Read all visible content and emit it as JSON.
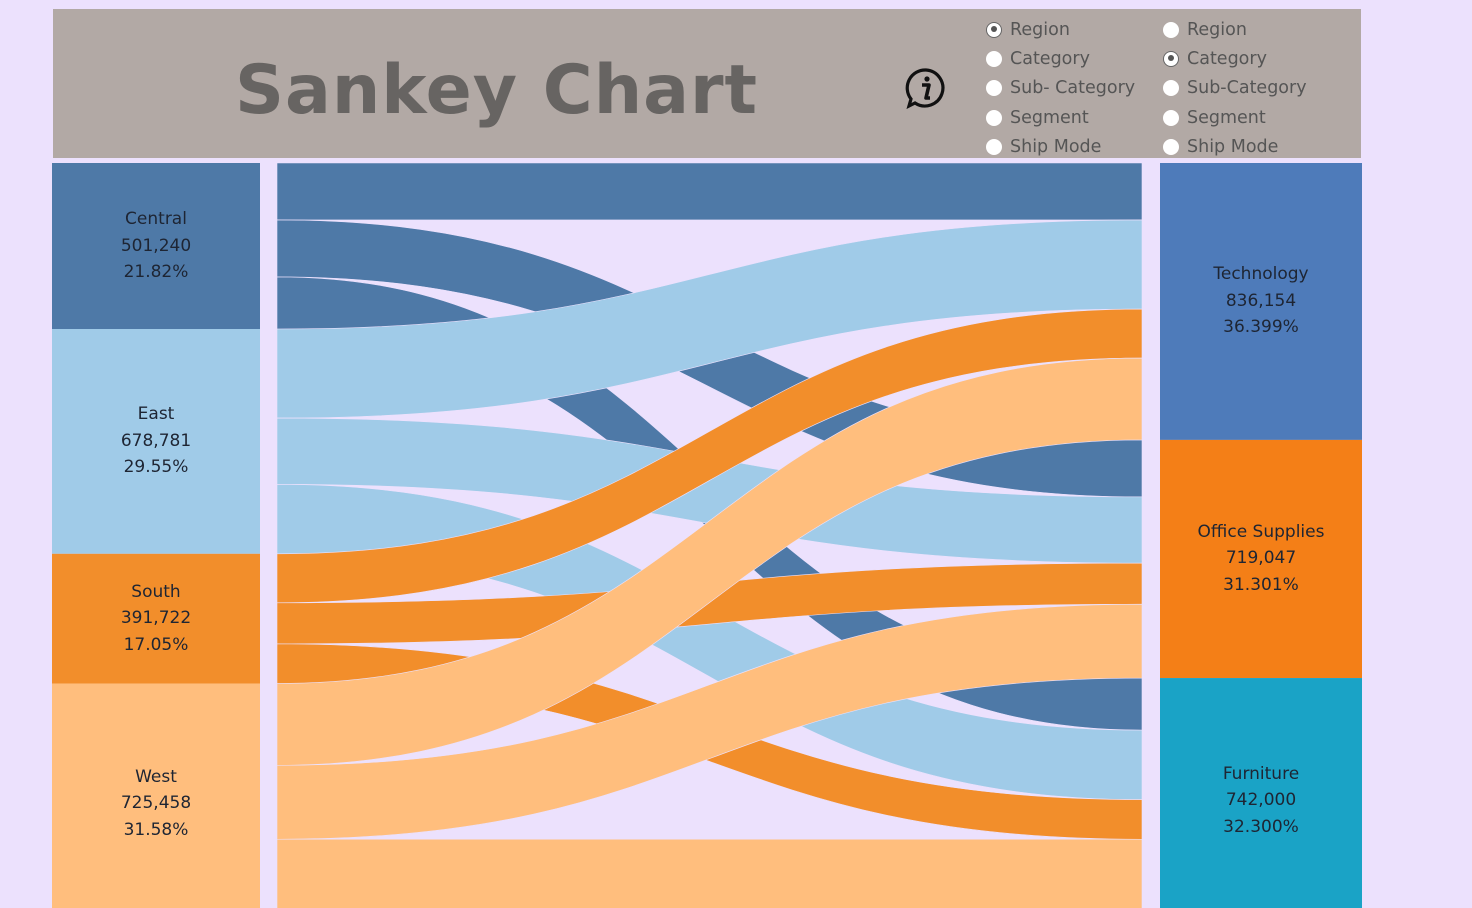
{
  "header": {
    "title": "Sankey Chart",
    "info_icon": "info-speech-bubble-icon",
    "source_options": [
      {
        "label": "Region",
        "selected": true
      },
      {
        "label": "Category",
        "selected": false
      },
      {
        "label": "Sub- Category",
        "selected": false
      },
      {
        "label": "Segment",
        "selected": false
      },
      {
        "label": "Ship Mode",
        "selected": false
      }
    ],
    "target_options": [
      {
        "label": "Region",
        "selected": false
      },
      {
        "label": "Category",
        "selected": true
      },
      {
        "label": "Sub-Category",
        "selected": false
      },
      {
        "label": "Segment",
        "selected": false
      },
      {
        "label": "Ship Mode",
        "selected": false
      }
    ]
  },
  "chart_data": {
    "type": "sankey",
    "title": "Sankey Chart",
    "sources": [
      {
        "name": "Central",
        "value": 501240,
        "value_label": "501,240",
        "pct_label": "21.82%",
        "color": "#4e79a7"
      },
      {
        "name": "East",
        "value": 678781,
        "value_label": "678,781",
        "pct_label": "29.55%",
        "color": "#a0cbe8"
      },
      {
        "name": "South",
        "value": 391722,
        "value_label": "391,722",
        "pct_label": "17.05%",
        "color": "#f28e2b"
      },
      {
        "name": "West",
        "value": 725458,
        "value_label": "725,458",
        "pct_label": "31.58%",
        "color": "#ffbe7d"
      }
    ],
    "targets": [
      {
        "name": "Technology",
        "value": 836154,
        "value_label": "836,154",
        "pct_label": "36.399%",
        "color": "#4e7bba"
      },
      {
        "name": "Office Supplies",
        "value": 719047,
        "value_label": "719,047",
        "pct_label": "31.301%",
        "color": "#f47f17"
      },
      {
        "name": "Furniture",
        "value": 742000,
        "value_label": "742,000",
        "pct_label": "32.300%",
        "color": "#1aa3c6"
      }
    ],
    "flows": [
      {
        "source": "Central",
        "target": "Technology",
        "value": 172000
      },
      {
        "source": "Central",
        "target": "Office Supplies",
        "value": 172000
      },
      {
        "source": "Central",
        "target": "Furniture",
        "value": 157240
      },
      {
        "source": "East",
        "target": "Technology",
        "value": 269000
      },
      {
        "source": "East",
        "target": "Office Supplies",
        "value": 200000
      },
      {
        "source": "East",
        "target": "Furniture",
        "value": 209781
      },
      {
        "source": "South",
        "target": "Technology",
        "value": 148000
      },
      {
        "source": "South",
        "target": "Office Supplies",
        "value": 124000
      },
      {
        "source": "South",
        "target": "Furniture",
        "value": 119722
      },
      {
        "source": "West",
        "target": "Technology",
        "value": 247154
      },
      {
        "source": "West",
        "target": "Office Supplies",
        "value": 223047
      },
      {
        "source": "West",
        "target": "Furniture",
        "value": 255257
      }
    ]
  }
}
